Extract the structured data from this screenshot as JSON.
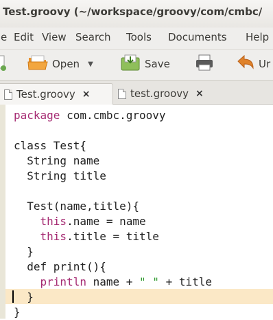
{
  "window": {
    "title": "Test.groovy (~/workspace/groovy/com/cmbc/"
  },
  "menu": {
    "items": [
      "e",
      "Edit",
      "View",
      "Search",
      "Tools",
      "Documents",
      "Help"
    ]
  },
  "toolbar": {
    "open_label": "Open",
    "save_label": "Save",
    "undo_label": "Ur"
  },
  "tabs": [
    {
      "label": "Test.groovy",
      "close": "×"
    },
    {
      "label": "test.groovy",
      "close": "×"
    }
  ],
  "editor": {
    "lines": {
      "l1_kw": "package",
      "l1_rest": " com.cmbc.groovy",
      "l3": "class Test{",
      "l4": "  String name",
      "l5": "  String title",
      "l7": "  Test(name,title){",
      "l8_kw": "this",
      "l8_rest": ".name = name",
      "l9_kw": "this",
      "l9_rest": ".title = title",
      "l10": "  }",
      "l11": "  def print(){",
      "l12_kw": "println",
      "l12_a": " name + ",
      "l12_str": "\" \"",
      "l12_b": " + title",
      "l13": "  }",
      "l14": "}"
    }
  },
  "colors": {
    "keyword": "#a52a72",
    "string": "#2e9a2e",
    "current_line": "#fbe8c6"
  }
}
